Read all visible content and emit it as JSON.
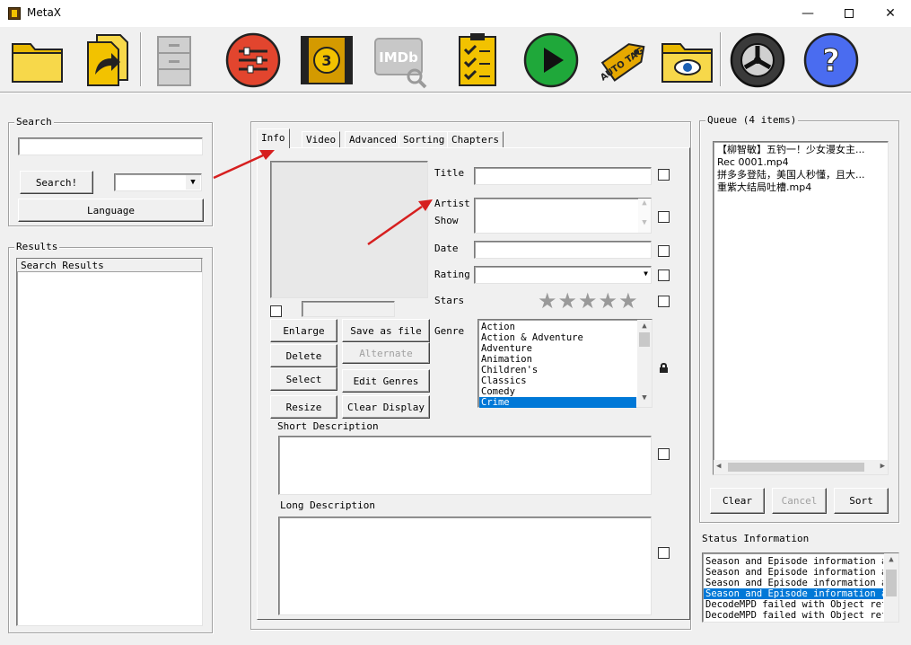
{
  "window": {
    "title": "MetaX"
  },
  "toolbar": {
    "icons": [
      "open-folder-icon",
      "open-file-icon",
      "cabinet-icon",
      "settings-sliders-icon",
      "film-countdown-icon",
      "imdb-search-icon",
      "checklist-icon",
      "play-icon",
      "auto-tag-icon",
      "view-folder-icon",
      "reel-icon",
      "help-icon"
    ],
    "imdb_text": "IMDb",
    "tag_text": "AUTO TAG",
    "film_number": "3",
    "help_text": "?"
  },
  "search": {
    "group_label": "Search",
    "input_value": "",
    "search_button": "Search!",
    "source_value": "",
    "language_button": "Language"
  },
  "results": {
    "group_label": "Results",
    "column_header": "Search Results"
  },
  "tabs": [
    "Info",
    "Video",
    "Advanced",
    "Sorting",
    "Chapters"
  ],
  "info": {
    "title_label": "Title",
    "artist_label": "Artist",
    "show_label": "Show",
    "date_label": "Date",
    "rating_label": "Rating",
    "stars_label": "Stars",
    "genre_label": "Genre",
    "title_value": "",
    "artist_value": "",
    "date_value": "",
    "rating_value": "",
    "stars_value": 0,
    "genres": [
      "Action",
      "Action & Adventure",
      "Adventure",
      "Animation",
      "Children's",
      "Classics",
      "Comedy",
      "Crime"
    ],
    "selected_genre": "Crime",
    "buttons": {
      "enlarge": "Enlarge",
      "save_as_file": "Save as file",
      "delete": "Delete",
      "alternate": "Alternate",
      "select": "Select",
      "edit_genres": "Edit Genres",
      "resize": "Resize",
      "clear_display": "Clear Display"
    },
    "short_description_label": "Short Description",
    "long_description_label": "Long Description",
    "short_description_value": "",
    "long_description_value": ""
  },
  "queue": {
    "group_label": "Queue (4 items)",
    "items": [
      "【柳智敏】五钓一！少女漫女主...",
      "Rec 0001.mp4",
      "拼多多登陆，美国人秒懂，且大...",
      "重紫大结局吐槽.mp4"
    ],
    "clear_button": "Clear",
    "cancel_button": "Cancel",
    "sort_button": "Sort"
  },
  "status": {
    "group_label": "Status Information",
    "lines": [
      "Season and Episode information al",
      "Season and Episode information al",
      "Season and Episode information al",
      "Season and Episode information al",
      "DecodeMPD failed with Object refe",
      "DecodeMPD failed with Object refe"
    ],
    "selected_index": 3
  },
  "colors": {
    "selection": "#0078d7",
    "annotation_arrow": "#d61f1f"
  }
}
